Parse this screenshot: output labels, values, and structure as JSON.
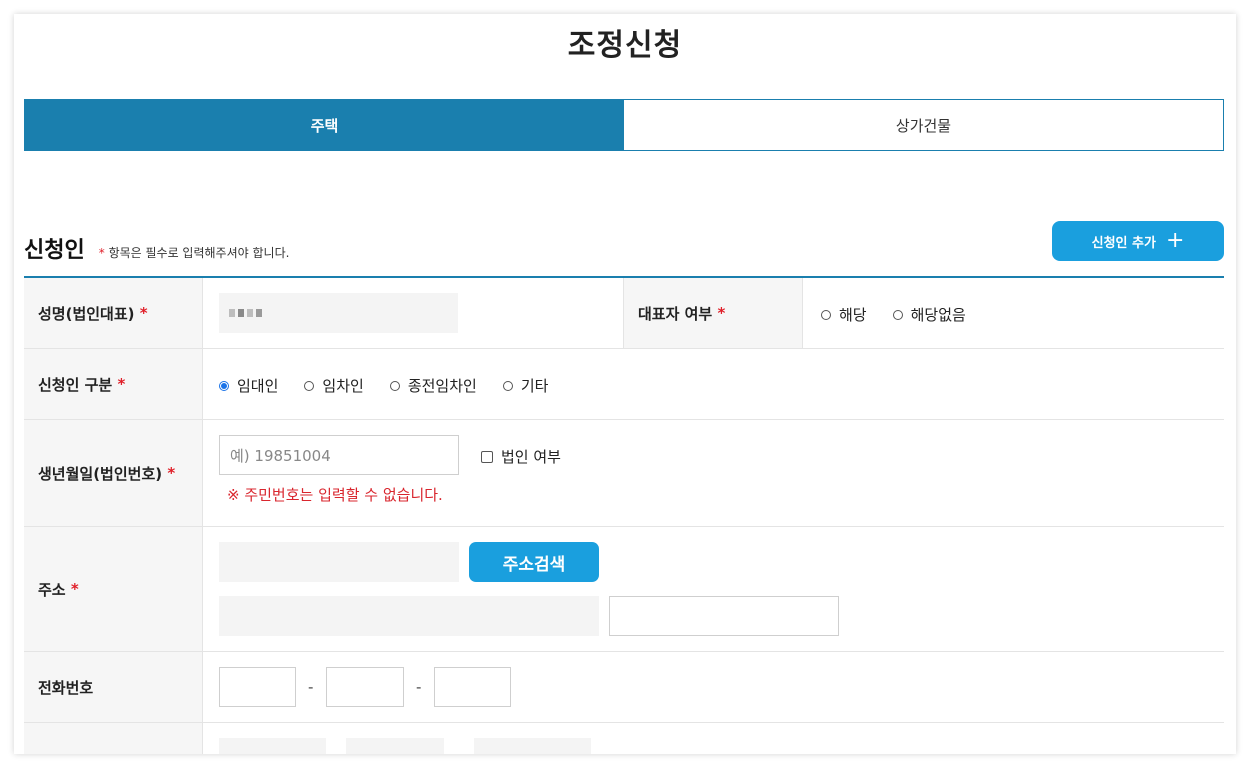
{
  "page": {
    "title": "조정신청"
  },
  "tabs": [
    {
      "label": "주택",
      "active": true
    },
    {
      "label": "상가건물",
      "active": false
    }
  ],
  "section": {
    "title": "신청인",
    "required_mark": "*",
    "note": "항목은 필수로 입력해주셔야 합니다.",
    "add_button_label": "신청인 추가",
    "add_button_icon": "plus-icon"
  },
  "form": {
    "name": {
      "label": "성명(법인대표)",
      "required": "*"
    },
    "representative": {
      "label": "대표자 여부",
      "required": "*",
      "options": [
        "해당",
        "해당없음"
      ]
    },
    "applicant_type": {
      "label": "신청인 구분",
      "required": "*",
      "options": [
        "임대인",
        "임차인",
        "종전임차인",
        "기타"
      ],
      "selected": "임대인"
    },
    "birth": {
      "label": "생년월일(법인번호)",
      "required": "*",
      "placeholder": "예) 19851004",
      "corporate_checkbox": "법인 여부",
      "warning": "※ 주민번호는 입력할 수 없습니다."
    },
    "address": {
      "label": "주소",
      "required": "*",
      "search_button": "주소검색"
    },
    "phone": {
      "label": "전화번호",
      "separator": "-"
    }
  },
  "colors": {
    "primary": "#1a7fae",
    "button": "#1a9fde",
    "required": "#e0202a",
    "warning": "#d9262e"
  }
}
